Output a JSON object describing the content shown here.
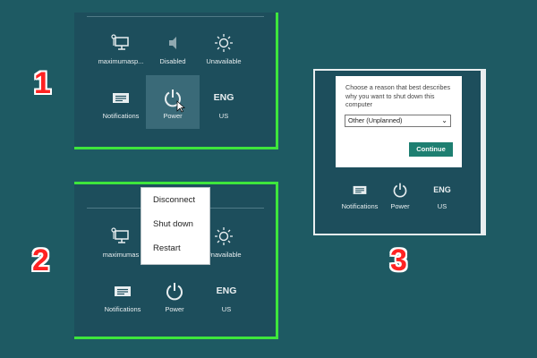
{
  "screen1": {
    "tiles": [
      {
        "label": "maximumasp...",
        "icon": "network-icon"
      },
      {
        "label": "Disabled",
        "icon": "speaker-icon"
      },
      {
        "label": "Unavailable",
        "icon": "brightness-icon"
      },
      {
        "label": "Notifications",
        "icon": "notifications-icon"
      },
      {
        "label": "Power",
        "icon": "power-icon"
      },
      {
        "label": "US",
        "top": "ENG"
      }
    ]
  },
  "screen2": {
    "menu": [
      "Disconnect",
      "Shut down",
      "Restart"
    ],
    "tiles": [
      {
        "label": "maximumas",
        "icon": "network-icon"
      },
      {
        "label": "Unavailable",
        "icon": "brightness-icon"
      },
      {
        "label": "Notifications",
        "icon": "notifications-icon"
      },
      {
        "label": "Power",
        "icon": "power-icon"
      },
      {
        "label": "US",
        "top": "ENG"
      }
    ]
  },
  "screen3": {
    "dialog_text": "Choose a reason that best describes why you want to shut down this computer",
    "select_value": "Other (Unplanned)",
    "continue_label": "Continue",
    "tiles": [
      {
        "label": "Notifications",
        "icon": "notifications-icon"
      },
      {
        "label": "Power",
        "icon": "power-icon"
      },
      {
        "label": "US",
        "top": "ENG"
      }
    ]
  },
  "step_numbers": [
    "1",
    "2",
    "3"
  ],
  "colors": {
    "background": "#1e5a63",
    "panel": "#1d4e5c",
    "highlight_border": "#3ee63c",
    "step_number": "#ff2222",
    "continue_button": "#1e7f71"
  }
}
